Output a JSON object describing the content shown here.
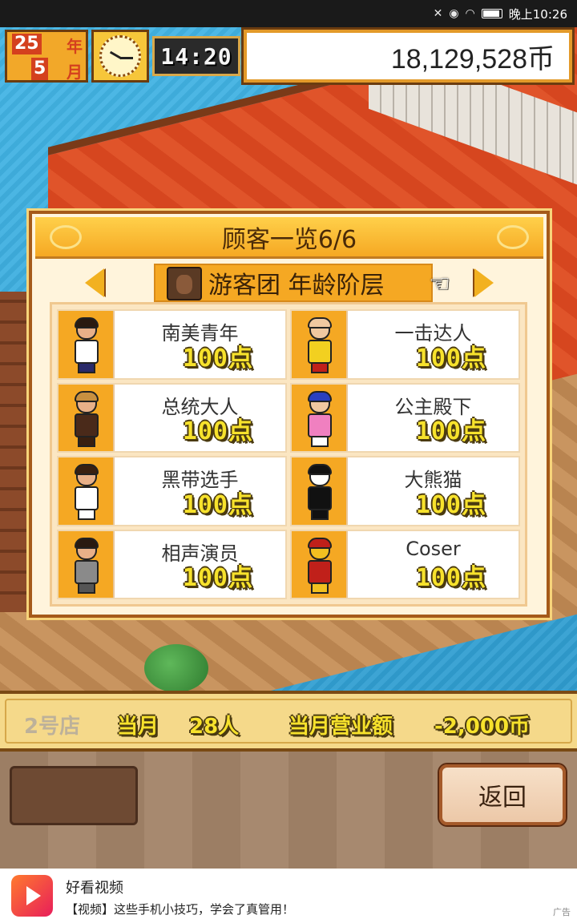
{
  "status_bar": {
    "time": "晚上10:26"
  },
  "hud": {
    "year": "25",
    "year_label": "年",
    "month": "5",
    "month_label": "月",
    "time": "14:20",
    "money": "18,129,528币"
  },
  "panel": {
    "title": "顾客一览6/6",
    "category": "游客团 年龄阶层",
    "customers": [
      {
        "name": "南美青年",
        "points": "100点",
        "sprite": {
          "hair": "#2a1a10",
          "skin": "#e8b088",
          "body": "#ffffff",
          "legs": "#2a2a6a"
        }
      },
      {
        "name": "一击达人",
        "points": "100点",
        "sprite": {
          "hair": "#f0c8a0",
          "skin": "#f0c8a0",
          "body": "#f2d020",
          "legs": "#c0201a"
        }
      },
      {
        "name": "总统大人",
        "points": "100点",
        "sprite": {
          "hair": "#c89040",
          "skin": "#e8b088",
          "body": "#4a2a1a",
          "legs": "#3a2010"
        }
      },
      {
        "name": "公主殿下",
        "points": "100点",
        "sprite": {
          "hair": "#2a40c0",
          "skin": "#f0c8a0",
          "body": "#f080c0",
          "legs": "#ffffff"
        }
      },
      {
        "name": "黑带选手",
        "points": "100点",
        "sprite": {
          "hair": "#3a2010",
          "skin": "#e8b088",
          "body": "#ffffff",
          "legs": "#ffffff"
        }
      },
      {
        "name": "大熊猫",
        "points": "100点",
        "sprite": {
          "hair": "#111111",
          "skin": "#ffffff",
          "body": "#111111",
          "legs": "#111111"
        }
      },
      {
        "name": "相声演员",
        "points": "100点",
        "sprite": {
          "hair": "#2a1a10",
          "skin": "#e8b088",
          "body": "#8a8a8a",
          "legs": "#555555"
        }
      },
      {
        "name": "Coser",
        "points": "100点",
        "sprite": {
          "hair": "#c0201a",
          "skin": "#f2c020",
          "body": "#c0201a",
          "legs": "#f2c020"
        }
      }
    ]
  },
  "statbar": {
    "store": "2号店",
    "month_label": "当月",
    "count": "28人",
    "sales_label": "当月营业额",
    "sales": "-2,000币"
  },
  "menu": {
    "back_label": "返回"
  },
  "ad": {
    "title": "好看视频",
    "desc": "【视频】这些手机小技巧，学会了真管用！",
    "tag": "广告"
  }
}
